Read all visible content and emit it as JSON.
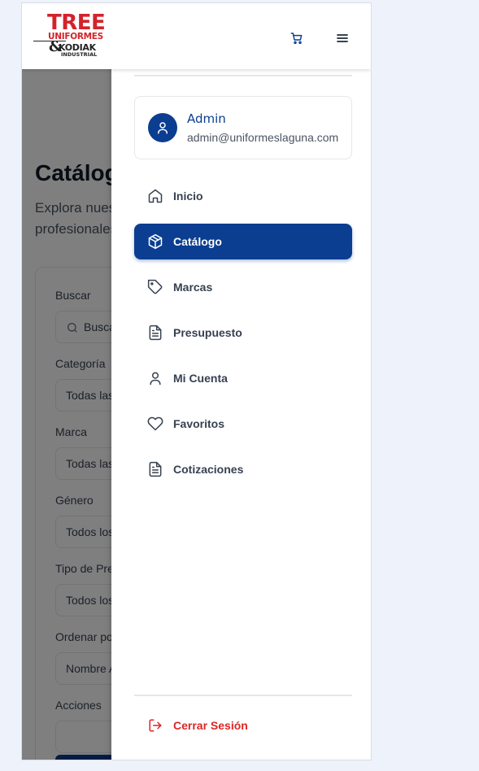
{
  "brand": {
    "line1": "TREE",
    "line2": "UNIFORMES",
    "amp": "&",
    "line3": "KODIAK",
    "line4": "INDUSTRIAL"
  },
  "header": {
    "cart_icon": "shopping-cart-icon",
    "menu_icon": "hamburger-menu-icon"
  },
  "background_page": {
    "title": "Catálogo",
    "description": "Explora nuestra amplia gama de uniformes profesionales",
    "fields": [
      {
        "label": "Buscar",
        "value": "Buscar productos..."
      },
      {
        "label": "Categoría",
        "value": "Todas las categorías"
      },
      {
        "label": "Marca",
        "value": "Todas las marcas"
      },
      {
        "label": "Género",
        "value": "Todos los géneros"
      },
      {
        "label": "Tipo de Prenda",
        "value": "Todos los tipos"
      },
      {
        "label": "Ordenar por",
        "value": "Nombre A-Z"
      },
      {
        "label": "Acciones",
        "value": ""
      }
    ]
  },
  "user": {
    "name": "Admin",
    "email": "admin@uniformeslaguna.com"
  },
  "nav": [
    {
      "label": "Inicio",
      "icon": "home-icon",
      "active": false
    },
    {
      "label": "Catálogo",
      "icon": "package-icon",
      "active": true
    },
    {
      "label": "Marcas",
      "icon": "tag-icon",
      "active": false
    },
    {
      "label": "Presupuesto",
      "icon": "document-icon",
      "active": false
    },
    {
      "label": "Mi Cuenta",
      "icon": "user-icon",
      "active": false
    },
    {
      "label": "Favoritos",
      "icon": "heart-icon",
      "active": false
    },
    {
      "label": "Cotizaciones",
      "icon": "document-icon",
      "active": false
    }
  ],
  "logout": {
    "label": "Cerrar Sesión",
    "icon": "logout-icon"
  },
  "colors": {
    "primary": "#0b3d91",
    "brand_red": "#d3232a",
    "danger": "#dc2626",
    "page_bg": "#eef2fa"
  }
}
